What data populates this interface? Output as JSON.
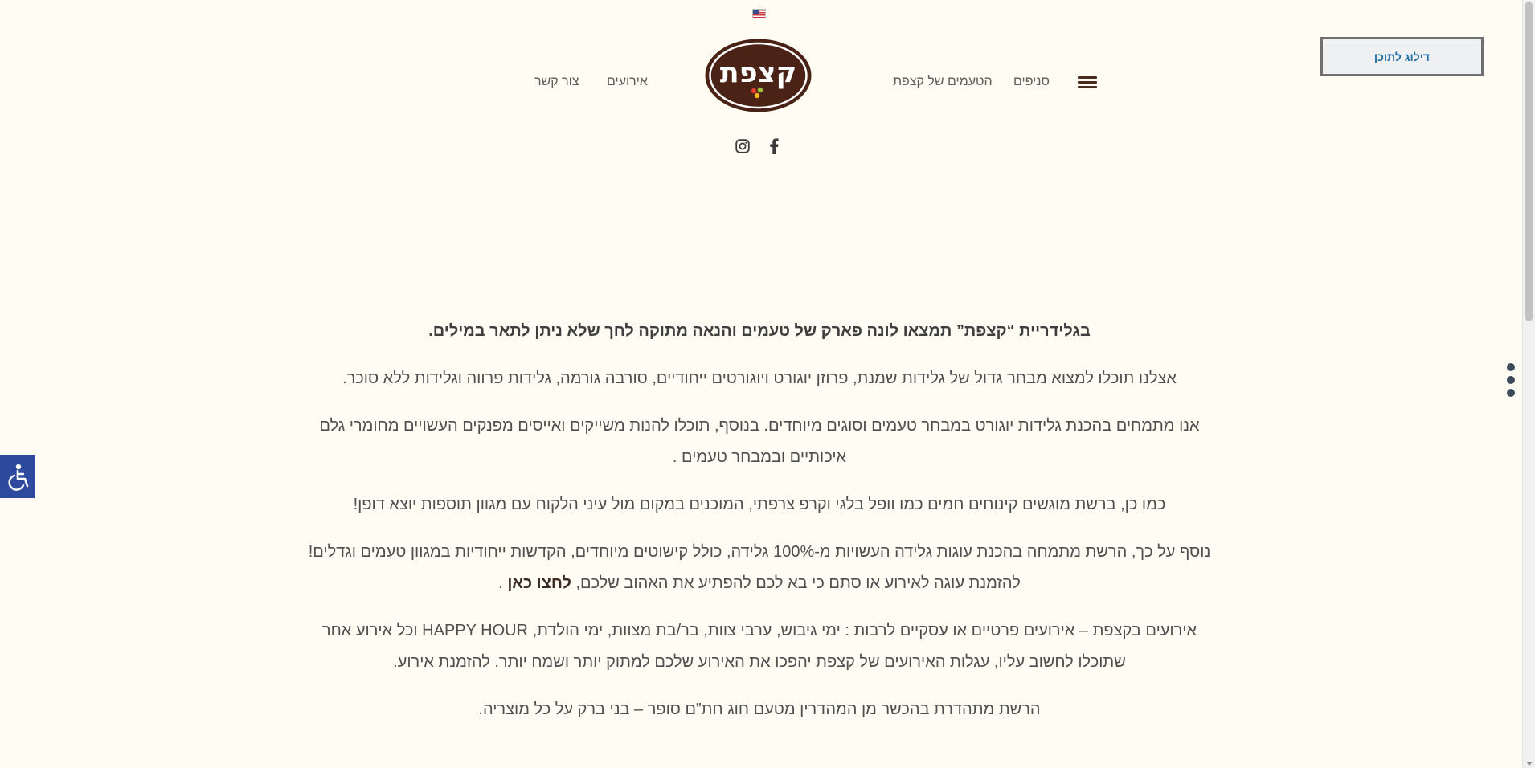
{
  "header": {
    "language_flag": "us-flag-icon",
    "logo_text": "קצפת",
    "nav_right": [
      "סניפים",
      "הטעמים של קצפת"
    ],
    "nav_left": [
      "אירועים",
      "צור קשר"
    ],
    "skip_button": "דילוג לתוכן"
  },
  "social": [
    "facebook-icon",
    "instagram-icon"
  ],
  "content": {
    "lead": "בגלידריית “קצפת” תמצאו לונה פארק של טעמים והנאה מתוקה לחך שלא ניתן לתאר במילים.",
    "p1": "אצלנו תוכלו למצוא מבחר גדול של גלידות שמנת, פרוזן יוגורט ויוגורטים ייחודיים, סורבה גורמה, גלידות פרווה וגלידות ללא סוכר.",
    "p2": "אנו מתמחים בהכנת גלידות יוגורט במבחר טעמים וסוגים מיוחדים. בנוסף, תוכלו להנות משייקים ואייסים מפנקים העשויים מחומרי גלם איכותיים ובמבחר טעמים .",
    "p3": "כמו כן, ברשת מוגשים קינוחים חמים כמו וופל בלגי וקרפ צרפתי, המוכנים במקום מול עיני הלקוח עם מגוון תוספות יוצא דופן!",
    "p4a": "נוסף על כך, הרשת מתמחה בהכנת עוגות גלידה העשויות מ-100% גלידה, כולל קישוטים מיוחדים, הקדשות ייחודיות במגוון טעמים וגדלים!",
    "p4b": "להזמנת עוגה לאירוע או סתם כי בא לכם להפתיע את האהוב שלכם, ",
    "p4_link": "לחצו כאן",
    "p4c": " .",
    "p5": "אירועים בקצפת – אירועים פרטיים או עסקיים לרבות : ימי גיבוש, ערבי צוות, בר/בת מצוות, ימי הולדת, HAPPY HOUR וכל אירוע אחר שתוכלו לחשוב עליו, עגלות האירועים של קצפת יהפכו את האירוע שלכם למתוק יותר ושמח יותר.  להזמנת אירוע.",
    "p6": "הרשת מתהדרת בהכשר מן המהדרין מטעם חוג חת”ם סופר – בני ברק על כל מוצריה."
  },
  "accessibility_icon": "wheelchair-icon",
  "colors": {
    "background": "#fefcf3",
    "logo_brown": "#4a2216",
    "accessibility_blue": "#2e4a9e",
    "text": "#4e4e4e"
  }
}
